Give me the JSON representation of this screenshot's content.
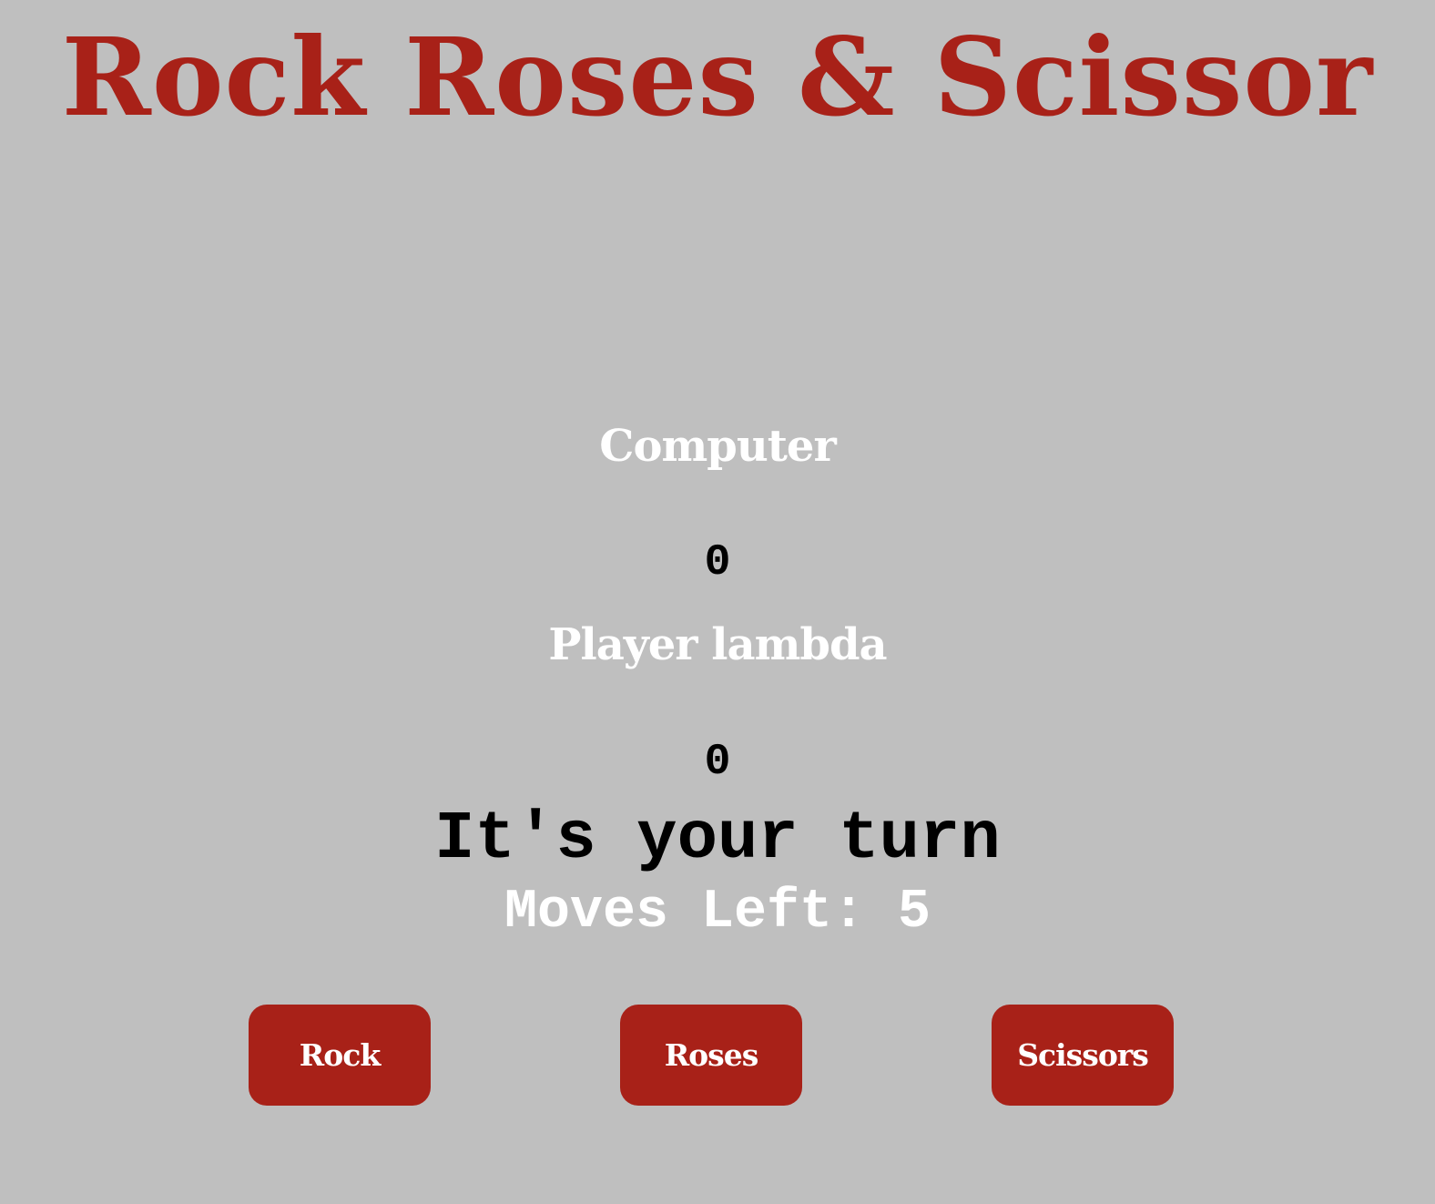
{
  "header": {
    "title": "Rock Roses & Scissor"
  },
  "scoreboard": {
    "computer_label": "Computer",
    "computer_score": "0",
    "player_label": "Player lambda",
    "player_score": "0"
  },
  "status": {
    "message": "It's your turn",
    "moves_left": "Moves Left: 5"
  },
  "choices": {
    "rock_label": "Rock",
    "roses_label": "Roses",
    "scissors_label": "Scissors"
  },
  "colors": {
    "background": "#bfbfbf",
    "accent": "#a82118",
    "label_text": "#ffffff",
    "score_text": "#000000"
  }
}
